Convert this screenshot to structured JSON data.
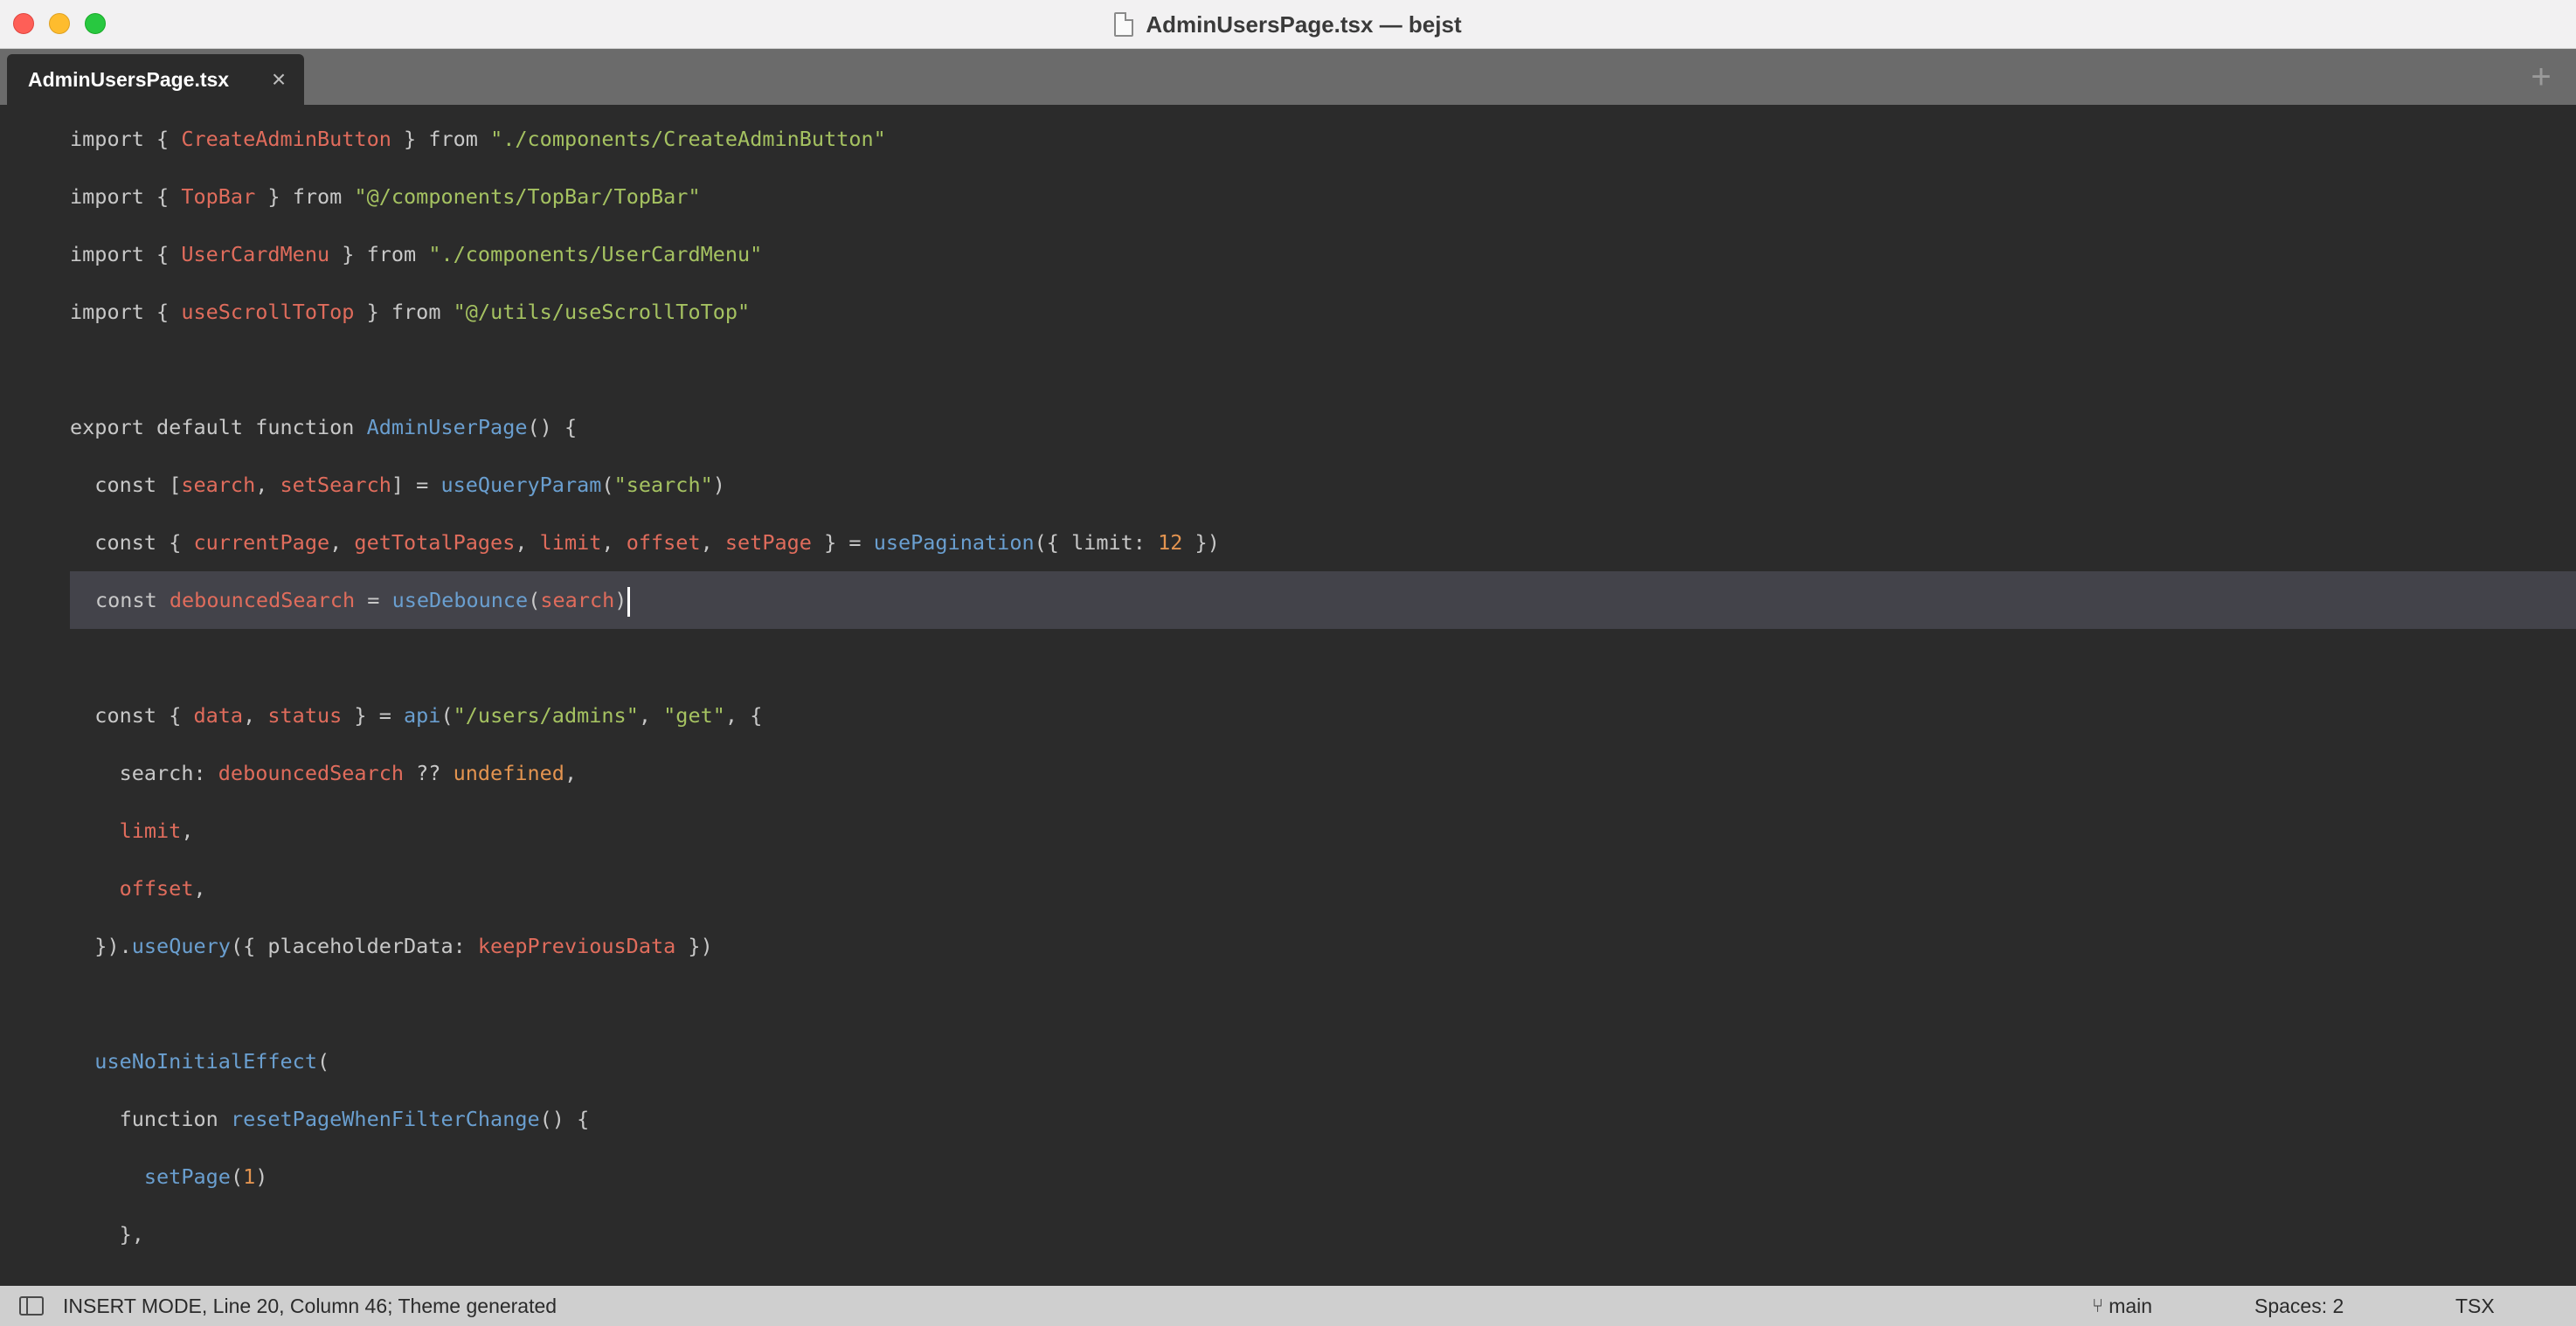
{
  "window": {
    "title": "AdminUsersPage.tsx — bejst"
  },
  "tabs": [
    {
      "label": "AdminUsersPage.tsx",
      "close": "×"
    }
  ],
  "new_tab": "+",
  "editor": {
    "active_line_index": 8,
    "lines": [
      [
        [
          "k",
          "import "
        ],
        [
          "p",
          "{ "
        ],
        [
          "v",
          "CreateAdminButton"
        ],
        [
          "p",
          " } "
        ],
        [
          "k",
          "from "
        ],
        [
          "s",
          "\"./components/CreateAdminButton\""
        ]
      ],
      [
        [
          "k",
          "import "
        ],
        [
          "p",
          "{ "
        ],
        [
          "v",
          "TopBar"
        ],
        [
          "p",
          " } "
        ],
        [
          "k",
          "from "
        ],
        [
          "s",
          "\"@/components/TopBar/TopBar\""
        ]
      ],
      [
        [
          "k",
          "import "
        ],
        [
          "p",
          "{ "
        ],
        [
          "v",
          "UserCardMenu"
        ],
        [
          "p",
          " } "
        ],
        [
          "k",
          "from "
        ],
        [
          "s",
          "\"./components/UserCardMenu\""
        ]
      ],
      [
        [
          "k",
          "import "
        ],
        [
          "p",
          "{ "
        ],
        [
          "v",
          "useScrollToTop"
        ],
        [
          "p",
          " } "
        ],
        [
          "k",
          "from "
        ],
        [
          "s",
          "\"@/utils/useScrollToTop\""
        ]
      ],
      [],
      [
        [
          "k",
          "export default function "
        ],
        [
          "f",
          "AdminUserPage"
        ],
        [
          "p",
          "() {"
        ]
      ],
      [
        [
          "k",
          "  const "
        ],
        [
          "p",
          "["
        ],
        [
          "v",
          "search"
        ],
        [
          "p",
          ", "
        ],
        [
          "v",
          "setSearch"
        ],
        [
          "p",
          "] = "
        ],
        [
          "f",
          "useQueryParam"
        ],
        [
          "p",
          "("
        ],
        [
          "s",
          "\"search\""
        ],
        [
          "p",
          ")"
        ]
      ],
      [
        [
          "k",
          "  const "
        ],
        [
          "p",
          "{ "
        ],
        [
          "v",
          "currentPage"
        ],
        [
          "p",
          ", "
        ],
        [
          "v",
          "getTotalPages"
        ],
        [
          "p",
          ", "
        ],
        [
          "v",
          "limit"
        ],
        [
          "p",
          ", "
        ],
        [
          "v",
          "offset"
        ],
        [
          "p",
          ", "
        ],
        [
          "v",
          "setPage"
        ],
        [
          "p",
          " } = "
        ],
        [
          "f",
          "usePagination"
        ],
        [
          "p",
          "({ limit: "
        ],
        [
          "n",
          "12"
        ],
        [
          "p",
          " })"
        ]
      ],
      [
        [
          "k",
          "const "
        ],
        [
          "v",
          "debouncedSearch"
        ],
        [
          "p",
          " = "
        ],
        [
          "f",
          "useDebounce"
        ],
        [
          "p",
          "("
        ],
        [
          "v",
          "search"
        ],
        [
          "p",
          ")"
        ]
      ],
      [],
      [
        [
          "k",
          "  const "
        ],
        [
          "p",
          "{ "
        ],
        [
          "v",
          "data"
        ],
        [
          "p",
          ", "
        ],
        [
          "v",
          "status"
        ],
        [
          "p",
          " } = "
        ],
        [
          "f",
          "api"
        ],
        [
          "p",
          "("
        ],
        [
          "s",
          "\"/users/admins\""
        ],
        [
          "p",
          ", "
        ],
        [
          "s",
          "\"get\""
        ],
        [
          "p",
          ", {"
        ]
      ],
      [
        [
          "p",
          "    search: "
        ],
        [
          "v",
          "debouncedSearch"
        ],
        [
          "p",
          " ?? "
        ],
        [
          "n",
          "undefined"
        ],
        [
          "p",
          ","
        ]
      ],
      [
        [
          "v",
          "    limit"
        ],
        [
          "p",
          ","
        ]
      ],
      [
        [
          "v",
          "    offset"
        ],
        [
          "p",
          ","
        ]
      ],
      [
        [
          "p",
          "  })."
        ],
        [
          "f",
          "useQuery"
        ],
        [
          "p",
          "({ placeholderData: "
        ],
        [
          "v",
          "keepPreviousData"
        ],
        [
          "p",
          " })"
        ]
      ],
      [],
      [
        [
          "f",
          "  useNoInitialEffect"
        ],
        [
          "p",
          "("
        ]
      ],
      [
        [
          "k",
          "    function "
        ],
        [
          "f",
          "resetPageWhenFilterChange"
        ],
        [
          "p",
          "() {"
        ]
      ],
      [
        [
          "f",
          "      setPage"
        ],
        [
          "p",
          "("
        ],
        [
          "n",
          "1"
        ],
        [
          "p",
          ")"
        ]
      ],
      [
        [
          "p",
          "    },"
        ]
      ]
    ]
  },
  "status_bar": {
    "mode": "INSERT MODE, Line 20, Column 46; Theme generated",
    "branch": "main",
    "spaces": "Spaces: 2",
    "syntax": "TSX"
  }
}
